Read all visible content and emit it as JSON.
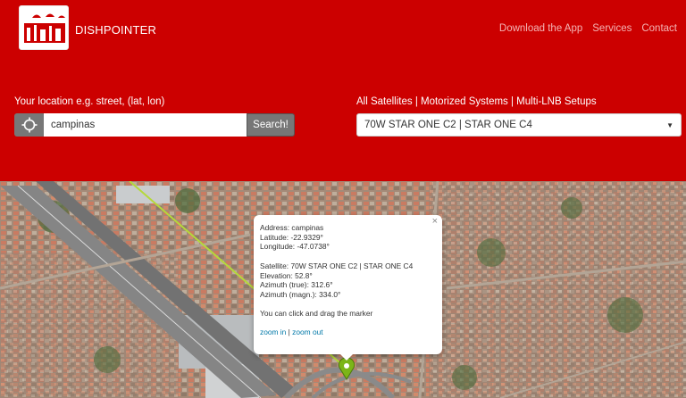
{
  "header": {
    "brand": "DISHPOINTER",
    "nav": [
      "Download the App",
      "Services",
      "Contact"
    ]
  },
  "location": {
    "label": "Your location e.g. street, (lat, lon)",
    "search_value": "campinas",
    "search_button": "Search!"
  },
  "satellite": {
    "links": "All Satellites | Motorized Systems | Multi-LNB Setups",
    "selected": "70W STAR ONE C2 | STAR ONE C4"
  },
  "popup": {
    "address": "Address: campinas",
    "latitude": "Latitude: -22.9329°",
    "longitude": "Longitude: -47.0738°",
    "satellite": "Satellite: 70W STAR ONE C2 | STAR ONE C4",
    "elevation": "Elevation: 52.8°",
    "azimuth_true": "Azimuth (true): 312.6°",
    "azimuth_magn": "Azimuth (magn.): 334.0°",
    "hint": "You can click and drag the marker",
    "zoom_in": "zoom in",
    "zoom_sep": " | ",
    "zoom_out": "zoom out",
    "close": "×"
  },
  "icons": {
    "locate": "crosshair-icon",
    "marker": "map-marker-icon",
    "dropdown": "caret-down-icon"
  },
  "colors": {
    "brand_red": "#cc0000",
    "button_gray": "#777777",
    "link_blue": "#0078a8",
    "line_green": "#b5d93a",
    "marker_green": "#7cb518"
  }
}
